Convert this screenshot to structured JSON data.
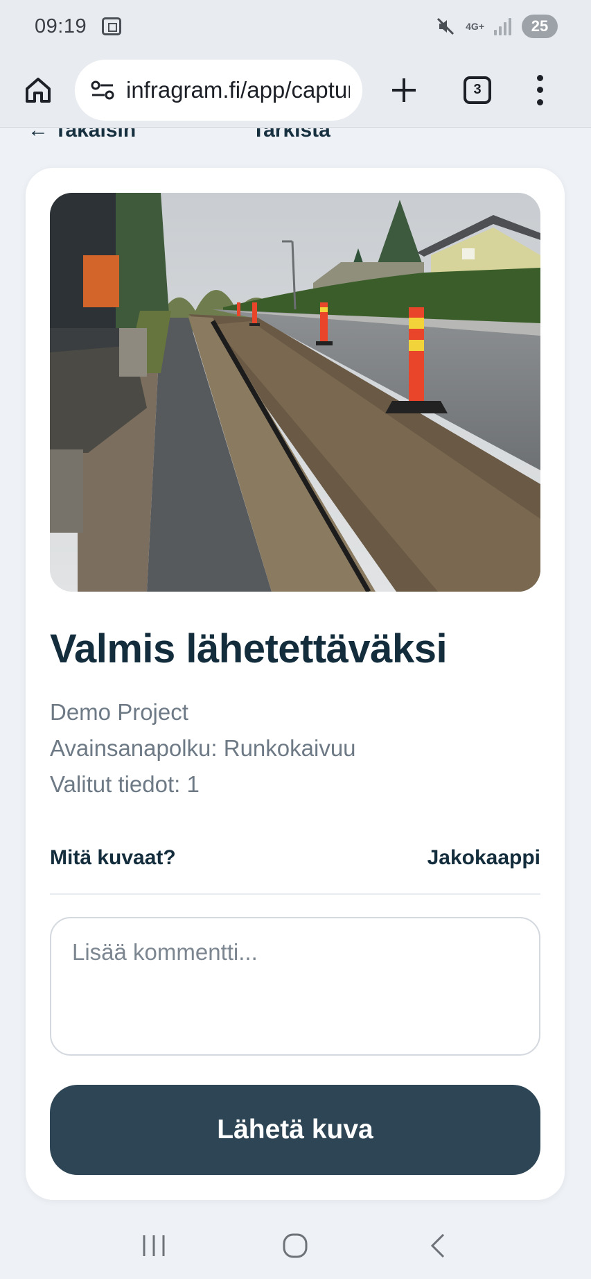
{
  "status_bar": {
    "time": "09:19",
    "network": "4G+",
    "battery": "25"
  },
  "browser": {
    "url": "infragram.fi/app/capture",
    "tab_count": "3"
  },
  "header": {
    "back_label": "← Takaisin",
    "title": "Tarkista"
  },
  "card": {
    "photo_icon": "captured-photo",
    "title": "Valmis lähetettäväksi",
    "project": "Demo Project",
    "keyword_path": "Avainsanapolku: Runkokaivuu",
    "selected_info": "Valitut tiedot: 1",
    "describe_label": "Mitä kuvaat?",
    "describe_value": "Jakokaappi",
    "comment_placeholder": "Lisää kommentti...",
    "send_label": "Lähetä kuva"
  },
  "colors": {
    "primary_button": "#2e4555",
    "title_text": "#142d3d",
    "muted_text": "#6d7a86",
    "background": "#eef1f5"
  }
}
